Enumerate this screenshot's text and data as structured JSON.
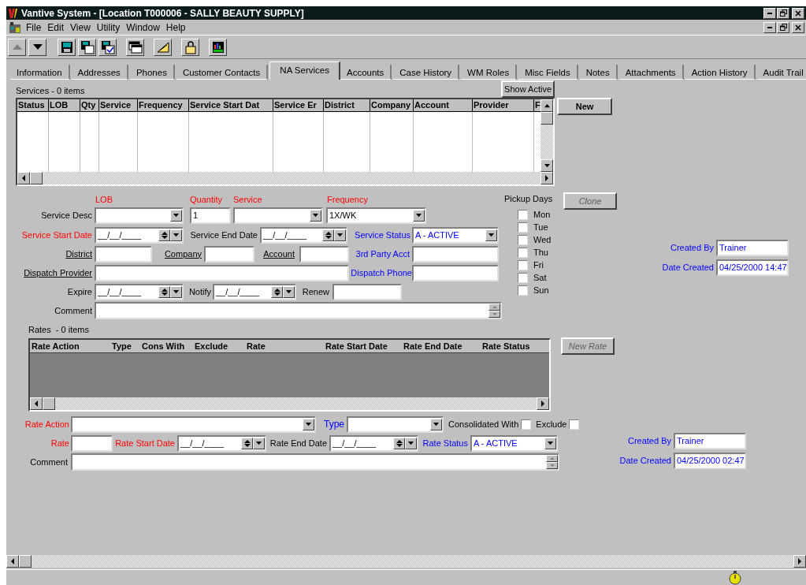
{
  "window": {
    "title": "Vantive System - [Location T000006 - SALLY BEAUTY SUPPLY]"
  },
  "menu": [
    "File",
    "Edit",
    "View",
    "Utility",
    "Window",
    "Help"
  ],
  "tabs": [
    {
      "label": "Information",
      "selected": false
    },
    {
      "label": "Addresses",
      "selected": false
    },
    {
      "label": "Phones",
      "selected": false
    },
    {
      "label": "Customer Contacts",
      "selected": false
    },
    {
      "label": "NA Services",
      "selected": true
    },
    {
      "label": "Accounts",
      "selected": false
    },
    {
      "label": "Case History",
      "selected": false
    },
    {
      "label": "WM Roles",
      "selected": false
    },
    {
      "label": "Misc Fields",
      "selected": false
    },
    {
      "label": "Notes",
      "selected": false
    },
    {
      "label": "Attachments",
      "selected": false
    },
    {
      "label": "Action History",
      "selected": false
    },
    {
      "label": "Audit Trail",
      "selected": false
    }
  ],
  "services": {
    "caption": "Services - 0 items",
    "show_active_button": {
      "label": "Show Active",
      "disabled": false
    },
    "new_button": {
      "label": "New",
      "disabled": false
    },
    "columns": [
      "Status",
      "LOB",
      "Qty",
      "Service",
      "Frequency",
      "Service Start Dat",
      "Service Er",
      "District",
      "Company",
      "Account",
      "Provider",
      "F"
    ]
  },
  "service_form": {
    "headers": [
      {
        "text": "LOB",
        "color": "#ff0000"
      },
      {
        "text": "Quantity",
        "color": "#ff0000"
      },
      {
        "text": "Service",
        "color": "#ff0000"
      },
      {
        "text": "Frequency",
        "color": "#ff0000"
      }
    ],
    "lines": [
      [
        {
          "kind": "label",
          "text": "Service Desc",
          "color": "#000000",
          "link": false
        },
        {
          "kind": "combo"
        },
        {
          "kind": "text",
          "value": "1"
        },
        {
          "kind": "combo"
        },
        {
          "kind": "combo",
          "value": "1X/WK"
        }
      ],
      [
        {
          "kind": "label",
          "text": "Service Start Date",
          "color": "#ff0000",
          "link": false
        },
        {
          "kind": "date",
          "value": "__/__/____"
        },
        {
          "kind": "label",
          "text": "Service End Date",
          "color": "#000000",
          "link": false
        },
        {
          "kind": "date",
          "value": "__/__/____"
        },
        {
          "kind": "label",
          "text": "Service Status",
          "color": "#0000ff",
          "link": false
        },
        {
          "kind": "combo",
          "value": "A - ACTIVE",
          "color": "#0000ff"
        }
      ],
      [
        {
          "kind": "label",
          "text": "District",
          "color": "#000000",
          "link": true
        },
        {
          "kind": "text"
        },
        {
          "kind": "label",
          "text": "Company",
          "color": "#000000",
          "link": true
        },
        {
          "kind": "text"
        },
        {
          "kind": "label",
          "text": "Account",
          "color": "#000000",
          "link": true
        },
        {
          "kind": "text"
        },
        {
          "kind": "label",
          "text": "3rd Party Acct",
          "color": "#0000ff",
          "link": false
        },
        {
          "kind": "text"
        }
      ],
      [
        {
          "kind": "label",
          "text": "Dispatch Provider",
          "color": "#000000",
          "link": true
        },
        {
          "kind": "text"
        },
        {
          "kind": "label",
          "text": "Dispatch Phone",
          "color": "#0000ff",
          "link": false
        },
        {
          "kind": "text"
        }
      ],
      [
        {
          "kind": "label",
          "text": "Expire",
          "color": "#000000",
          "link": false
        },
        {
          "kind": "date",
          "value": "__/__/____"
        },
        {
          "kind": "label",
          "text": "Notify",
          "color": "#000000",
          "link": false
        },
        {
          "kind": "date",
          "value": "__/__/____"
        },
        {
          "kind": "label",
          "text": "Renew",
          "color": "#000000",
          "link": false
        },
        {
          "kind": "text"
        }
      ],
      [
        {
          "kind": "label",
          "text": "Comment",
          "color": "#000000",
          "link": false
        },
        {
          "kind": "memo"
        }
      ]
    ]
  },
  "pickup": {
    "label": "Pickup Days",
    "days": [
      {
        "label": "Mon",
        "checked": false
      },
      {
        "label": "Tue",
        "checked": false
      },
      {
        "label": "Wed",
        "checked": false
      },
      {
        "label": "Thu",
        "checked": false
      },
      {
        "label": "Fri",
        "checked": false
      },
      {
        "label": "Sat",
        "checked": false
      },
      {
        "label": "Sun",
        "checked": false
      }
    ]
  },
  "clone_button": {
    "label": "Clone",
    "disabled": true
  },
  "service_record": {
    "lines": [
      [
        {
          "kind": "label",
          "text": "Created By",
          "color": "#0000ff",
          "link": false
        },
        {
          "kind": "text",
          "value": "Trainer",
          "color": "#0000ff"
        }
      ],
      [
        {
          "kind": "label",
          "text": "Date Created",
          "color": "#0000ff",
          "link": false
        },
        {
          "kind": "text",
          "value": "04/25/2000 14:47",
          "color": "#0000ff"
        }
      ]
    ]
  },
  "rates": {
    "caption": "Rates  - 0 items",
    "new_rate_button": {
      "label": "New Rate",
      "disabled": true
    },
    "columns": [
      "Rate Action",
      "Type",
      "Cons With",
      "Exclude",
      "Rate",
      "Rate Start Date",
      "Rate End Date",
      "Rate Status"
    ]
  },
  "rate_form": {
    "lines": [
      [
        {
          "kind": "label",
          "text": "Rate Action",
          "color": "#ff0000",
          "link": false
        },
        {
          "kind": "combo"
        },
        {
          "kind": "label",
          "text": "Type",
          "color": "#0000ff",
          "link": false
        },
        {
          "kind": "combo"
        },
        {
          "kind": "label",
          "text": "Consolidated With",
          "color": "#000000",
          "link": false
        },
        {
          "kind": "check",
          "checked": false
        },
        {
          "kind": "label",
          "text": "Exclude",
          "color": "#000000",
          "link": false
        },
        {
          "kind": "check",
          "checked": false
        }
      ],
      [
        {
          "kind": "label",
          "text": "Rate",
          "color": "#ff0000",
          "link": false
        },
        {
          "kind": "text"
        },
        {
          "kind": "label",
          "text": "Rate Start Date",
          "color": "#ff0000",
          "link": false
        },
        {
          "kind": "date",
          "value": "__/__/____"
        },
        {
          "kind": "label",
          "text": "Rate End Date",
          "color": "#000000",
          "link": false
        },
        {
          "kind": "date",
          "value": "__/__/____"
        },
        {
          "kind": "label",
          "text": "Rate Status",
          "color": "#0000ff",
          "link": false
        },
        {
          "kind": "combo",
          "value": "A - ACTIVE",
          "color": "#0000ff"
        }
      ],
      [
        {
          "kind": "label",
          "text": "Comment",
          "color": "#000000",
          "link": false
        },
        {
          "kind": "memo"
        }
      ]
    ]
  },
  "rate_record": {
    "lines": [
      [
        {
          "kind": "label",
          "text": "Created By",
          "color": "#0000ff",
          "link": false
        },
        {
          "kind": "text",
          "value": "Trainer",
          "color": "#0000ff"
        }
      ],
      [
        {
          "kind": "label",
          "text": "Date Created",
          "color": "#0000ff",
          "link": false
        },
        {
          "kind": "text",
          "value": "04/25/2000 02:47",
          "color": "#0000ff"
        }
      ]
    ]
  }
}
